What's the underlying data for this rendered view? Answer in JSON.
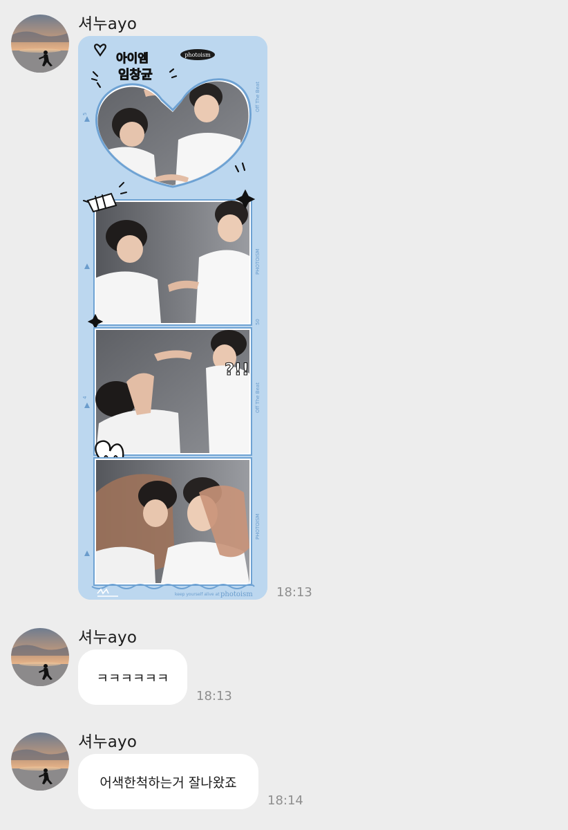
{
  "messages": [
    {
      "sender": "셔누ayo",
      "type": "image",
      "time": "18:13",
      "image": {
        "description": "photo booth strip",
        "top_label": "photoism",
        "doodle_text_1": "아이엠",
        "doodle_text_2": "임창균",
        "doodle_exclaim": "?!!",
        "side_text_a": "Off The Beat",
        "side_text_b": "PHOTOISM",
        "side_text_c": "Off The Beat",
        "side_text_d": "PHOTOISM",
        "frame_num_a": "5",
        "frame_num_b": "50",
        "frame_num_c": "4",
        "footer_small": "keep yourself alive at",
        "footer_brand": "photoism"
      }
    },
    {
      "sender": "셔누ayo",
      "type": "text",
      "text": "ㅋㅋㅋㅋㅋㅋ",
      "time": "18:13"
    },
    {
      "sender": "셔누ayo",
      "type": "text",
      "text": "어색한척하는거 잘나왔죠",
      "time": "18:14"
    }
  ],
  "colors": {
    "background": "#ededed",
    "bubble": "#ffffff",
    "photo_frame": "#bcd7ef",
    "timestamp": "#8e8e8e"
  }
}
